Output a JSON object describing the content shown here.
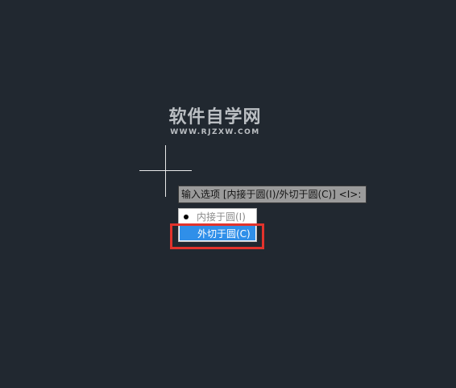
{
  "watermark": {
    "title": "软件自学网",
    "url": "WWW.RJZXW.COM"
  },
  "command_prompt": {
    "text": "输入选项 [内接于圆(I)/外切于圆(C)] <I>:"
  },
  "options": [
    {
      "label": "内接于圆(I)",
      "selected": true
    },
    {
      "label": "外切于圆(C)",
      "highlighted": true
    }
  ],
  "colors": {
    "canvas_background": "#212830",
    "crosshair": "#e8e8e8",
    "prompt_background": "#9b9b9b",
    "highlight_blue": "#2f8fe9",
    "annotation_red": "#e2332c"
  },
  "icons": {
    "selected_marker": "bullet-icon"
  }
}
